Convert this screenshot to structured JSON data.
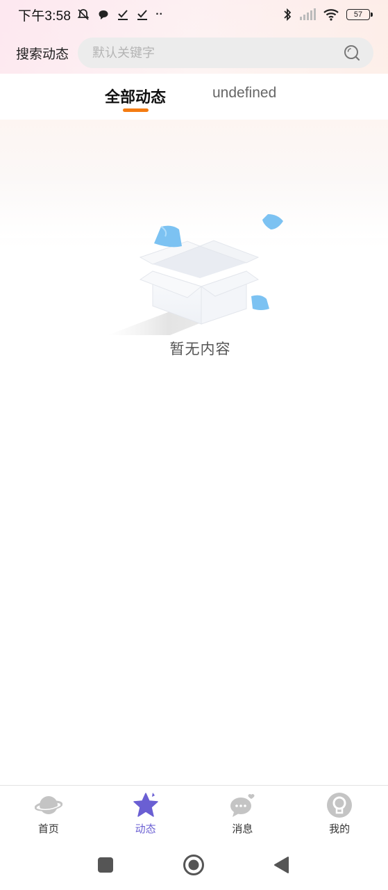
{
  "status_bar": {
    "time": "下午3:58",
    "battery": "57",
    "more_dots": "··"
  },
  "search": {
    "label": "搜索动态",
    "placeholder": "默认关键字",
    "value": ""
  },
  "tabs": [
    {
      "label": "全部动态",
      "active": true
    },
    {
      "label": "undefined",
      "active": false
    }
  ],
  "empty_state": {
    "text": "暂无内容"
  },
  "bottom_nav": [
    {
      "label": "首页",
      "icon": "planet-icon",
      "active": false
    },
    {
      "label": "动态",
      "icon": "star-icon",
      "active": true
    },
    {
      "label": "消息",
      "icon": "chat-bubble-icon",
      "active": false
    },
    {
      "label": "我的",
      "icon": "profile-icon",
      "active": false
    }
  ],
  "colors": {
    "accent_orange": "#f47c12",
    "active_nav": "#6a5fd3",
    "inactive_icon": "#c4c4c4"
  }
}
